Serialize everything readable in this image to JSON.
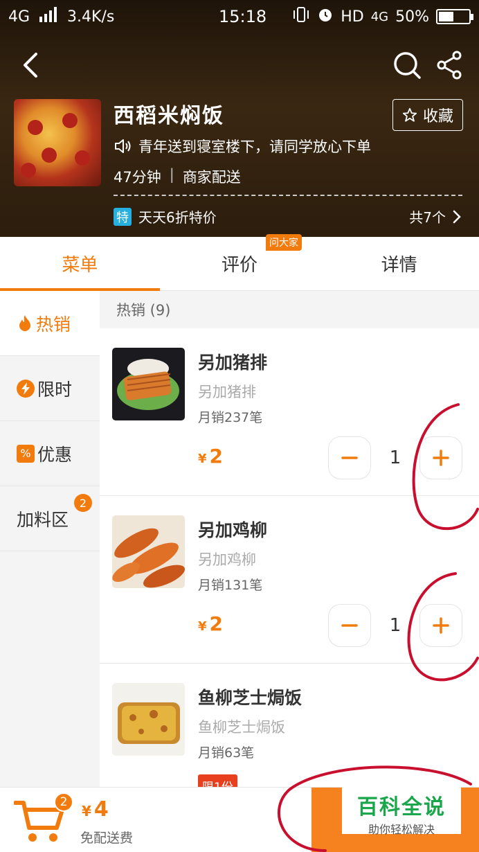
{
  "status_bar": {
    "network": "4G",
    "speed": "3.4K/s",
    "time": "15:18",
    "hd_label": "HD",
    "network_right": "4G",
    "battery": "50%",
    "battery_level": 0.5
  },
  "shop": {
    "name": "西稻米焖饭",
    "favorite_label": "收藏",
    "notice": "青年送到寝室楼下，请同学放心下单",
    "delivery_time": "47分钟",
    "delivery_sep": "|",
    "delivery_mode": "商家配送",
    "promo_tag": "特",
    "promo_text": "天天6折特价",
    "promo_count": "共7个"
  },
  "tabs": [
    {
      "label": "菜单",
      "active": true
    },
    {
      "label": "评价",
      "badge": "问大家"
    },
    {
      "label": "详情"
    }
  ],
  "sidebar": {
    "items": [
      {
        "label": "热销",
        "icon": "flame-icon",
        "active": true
      },
      {
        "label": "限时",
        "icon": "lightning-icon"
      },
      {
        "label": "优惠",
        "icon": "percent-icon"
      },
      {
        "label": "加料区",
        "badge": "2"
      }
    ]
  },
  "menu": {
    "section_title": "热销 (9)",
    "items": [
      {
        "name": "另加猪排",
        "desc": "另加猪排",
        "sales": "月销237笔",
        "currency": "¥",
        "price": "2",
        "qty": "1"
      },
      {
        "name": "另加鸡柳",
        "desc": "另加鸡柳",
        "sales": "月销131笔",
        "currency": "¥",
        "price": "2",
        "qty": "1"
      },
      {
        "name": "鱼柳芝士焗饭",
        "desc": "鱼柳芝士焗饭",
        "sales": "月销63笔",
        "limit": "限1份"
      }
    ]
  },
  "cart": {
    "count": "2",
    "currency": "¥",
    "total": "4",
    "shipping": "免配送费"
  },
  "watermark": {
    "main": "百科全说",
    "sub": "助你轻松解决"
  },
  "colors": {
    "accent": "#f27b0d",
    "annotation": "#c8102e",
    "watermark_green": "#1aa64a"
  }
}
